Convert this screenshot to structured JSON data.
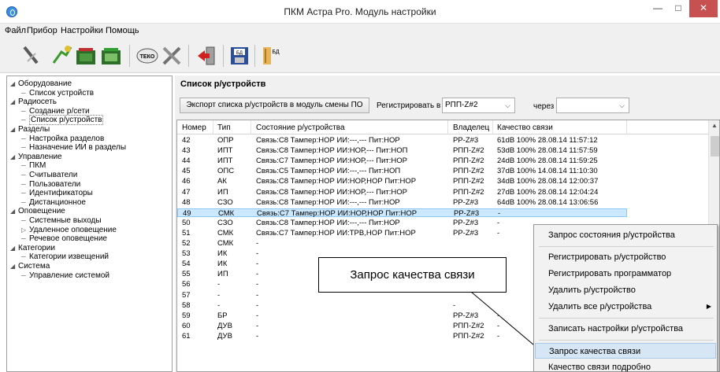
{
  "window": {
    "title": "ПКМ Астра Pro. Модуль настройки"
  },
  "menu": [
    "Файл",
    "Прибор",
    "Настройки",
    "Помощь"
  ],
  "toolbar_icons": [
    "disconnect-icon",
    "connect-icon",
    "read-device-icon",
    "write-device-icon",
    "teko-icon",
    "tools-icon",
    "exit-icon",
    "save-db-icon",
    "open-db-icon"
  ],
  "tree": [
    {
      "label": "Оборудование",
      "level": 0,
      "expanded": true
    },
    {
      "label": "Список устройств",
      "level": 1
    },
    {
      "label": "Радиосеть",
      "level": 0,
      "expanded": true
    },
    {
      "label": "Создание р/сети",
      "level": 1
    },
    {
      "label": "Список р/устройств",
      "level": 1,
      "selected": true
    },
    {
      "label": "Разделы",
      "level": 0,
      "expanded": true
    },
    {
      "label": "Настройка разделов",
      "level": 1
    },
    {
      "label": "Назначение ИИ в разделы",
      "level": 1
    },
    {
      "label": "Управление",
      "level": 0,
      "expanded": true
    },
    {
      "label": "ПКМ",
      "level": 1
    },
    {
      "label": "Считыватели",
      "level": 1
    },
    {
      "label": "Пользователи",
      "level": 1
    },
    {
      "label": "Идентификаторы",
      "level": 1
    },
    {
      "label": "Дистанционное",
      "level": 1
    },
    {
      "label": "Оповещение",
      "level": 0,
      "expanded": true
    },
    {
      "label": "Системные выходы",
      "level": 1
    },
    {
      "label": "Удаленное оповещение",
      "level": 1,
      "collapsed": true
    },
    {
      "label": "Речевое оповещение",
      "level": 1
    },
    {
      "label": "Категории",
      "level": 0,
      "expanded": true
    },
    {
      "label": "Категории извещений",
      "level": 1
    },
    {
      "label": "Система",
      "level": 0,
      "expanded": true
    },
    {
      "label": "Управление системой",
      "level": 1
    }
  ],
  "main": {
    "title": "Список р/устройств",
    "export_button": "Экспорт списка р/устройств в модуль смены ПО",
    "register_label": "Регистрировать в",
    "register_value": "РПП-Z#2",
    "through_label": "через",
    "through_value": ""
  },
  "table": {
    "columns": [
      "Номер",
      "Тип",
      "Состояние р/устройства",
      "Владелец",
      "Качество связи"
    ],
    "rows": [
      [
        "42",
        "ОПР",
        "Связь:С8 Тампер:НОР ИИ:---,--- Пит:НОР",
        "РР-Z#3",
        "61dB 100% 28.08.14 11:57:12"
      ],
      [
        "43",
        "ИПТ",
        "Связь:С8 Тампер:НОР ИИ:НОР,--- Пит:НОП",
        "РПП-Z#2",
        "53dB 100% 28.08.14 11:57:59"
      ],
      [
        "44",
        "ИПТ",
        "Связь:С7 Тампер:НОР ИИ:НОР,--- Пит:НОР",
        "РПП-Z#2",
        "24dB 100% 28.08.14 11:59:25"
      ],
      [
        "45",
        "ОПС",
        "Связь:С5 Тампер:НОР ИИ:---,--- Пит:НОП",
        "РПП-Z#2",
        "37dB 100% 14.08.14 11:10:30"
      ],
      [
        "46",
        "АК",
        "Связь:С8 Тампер:НОР ИИ:НОР,НОР Пит:НОР",
        "РПП-Z#2",
        "34dB 100% 28.08.14 12:00:37"
      ],
      [
        "47",
        "ИП",
        "Связь:С8 Тампер:НОР ИИ:НОР,--- Пит:НОР",
        "РПП-Z#2",
        "27dB 100% 28.08.14 12:04:24"
      ],
      [
        "48",
        "СЗО",
        "Связь:С8 Тампер:НОР ИИ:---,--- Пит:НОР",
        "РР-Z#3",
        "64dB 100% 28.08.14 13:06:56"
      ],
      [
        "49",
        "СМК",
        "Связь:С7 Тампер:НОР ИИ:НОР,НОР Пит:НОР",
        "РР-Z#3",
        "-"
      ],
      [
        "50",
        "СЗО",
        "Связь:С8 Тампер:НОР ИИ:---,--- Пит:НОР",
        "РР-Z#3",
        "-"
      ],
      [
        "51",
        "СМК",
        "Связь:С7 Тампер:НОР ИИ:ТРВ,НОР Пит:НОР",
        "РР-Z#3",
        "-"
      ],
      [
        "52",
        "СМК",
        "-",
        "",
        ""
      ],
      [
        "53",
        "ИК",
        "-",
        "",
        ""
      ],
      [
        "54",
        "ИК",
        "-",
        "",
        ""
      ],
      [
        "55",
        "ИП",
        "-",
        "",
        "-"
      ],
      [
        "56",
        "-",
        "-",
        "-",
        ""
      ],
      [
        "57",
        "-",
        "-",
        "",
        ""
      ],
      [
        "58",
        "-",
        "-",
        "-",
        ""
      ],
      [
        "59",
        "БР",
        "-",
        "РР-Z#3",
        "-"
      ],
      [
        "60",
        "ДУВ",
        "-",
        "РПП-Z#2",
        "-"
      ],
      [
        "61",
        "ДУВ",
        "-",
        "РПП-Z#2",
        "-"
      ]
    ],
    "selected_row": 7
  },
  "callout": "Запрос качества связи",
  "context_menu": [
    {
      "label": "Запрос состояния р/устройства"
    },
    {
      "separator": true
    },
    {
      "label": "Регистрировать р/устройство"
    },
    {
      "label": "Регистрировать программатор"
    },
    {
      "label": "Удалить р/устройство"
    },
    {
      "label": "Удалить все р/устройства",
      "submenu": true
    },
    {
      "separator": true
    },
    {
      "label": "Записать настройки р/устройства"
    },
    {
      "separator": true
    },
    {
      "label": "Запрос качества связи",
      "highlighted": true
    },
    {
      "label": "Качество связи подробно"
    }
  ]
}
